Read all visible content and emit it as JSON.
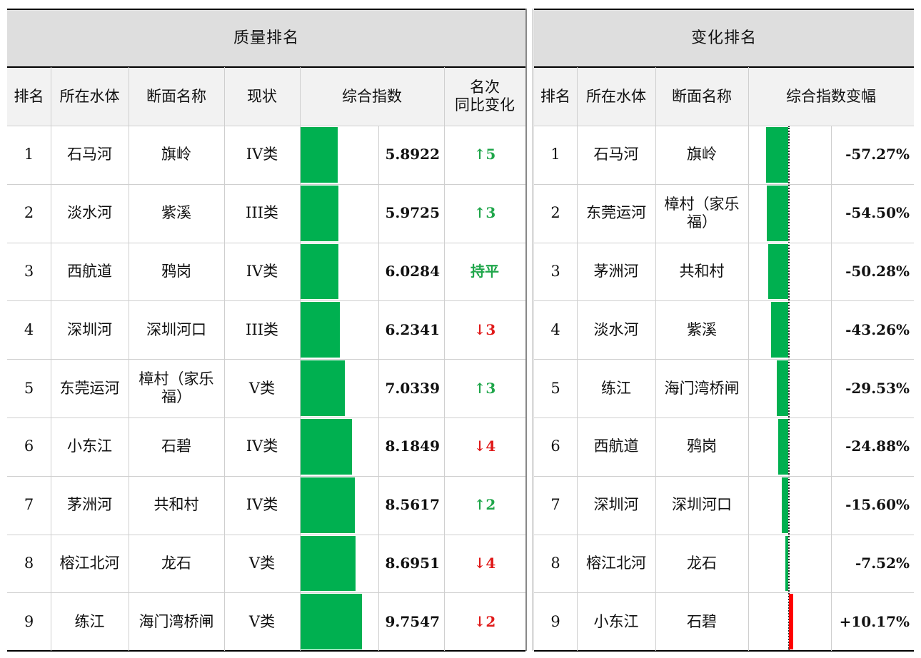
{
  "quality": {
    "title": "质量排名",
    "headers": {
      "rank": "排名",
      "water": "所在水体",
      "section": "断面名称",
      "status": "现状",
      "index": "综合指数",
      "change": "名次\n同比变化"
    },
    "bar_max": 12.0,
    "rows": [
      {
        "rank": "1",
        "water": "石马河",
        "section": "旗岭",
        "status": "IV类",
        "index": 5.8922,
        "index_label": "5.8922",
        "change": "↑5",
        "dir": "up"
      },
      {
        "rank": "2",
        "water": "淡水河",
        "section": "紫溪",
        "status": "III类",
        "index": 5.9725,
        "index_label": "5.9725",
        "change": "↑3",
        "dir": "up"
      },
      {
        "rank": "3",
        "water": "西航道",
        "section": "鸦岗",
        "status": "IV类",
        "index": 6.0284,
        "index_label": "6.0284",
        "change": "持平",
        "dir": "flat"
      },
      {
        "rank": "4",
        "water": "深圳河",
        "section": "深圳河口",
        "status": "III类",
        "index": 6.2341,
        "index_label": "6.2341",
        "change": "↓3",
        "dir": "down"
      },
      {
        "rank": "5",
        "water": "东莞运河",
        "section": "樟村（家乐\n福）",
        "status": "V类",
        "index": 7.0339,
        "index_label": "7.0339",
        "change": "↑3",
        "dir": "up"
      },
      {
        "rank": "6",
        "water": "小东江",
        "section": "石碧",
        "status": "IV类",
        "index": 8.1849,
        "index_label": "8.1849",
        "change": "↓4",
        "dir": "down"
      },
      {
        "rank": "7",
        "water": "茅洲河",
        "section": "共和村",
        "status": "IV类",
        "index": 8.5617,
        "index_label": "8.5617",
        "change": "↑2",
        "dir": "up"
      },
      {
        "rank": "8",
        "water": "榕江北河",
        "section": "龙石",
        "status": "V类",
        "index": 8.6951,
        "index_label": "8.6951",
        "change": "↓4",
        "dir": "down"
      },
      {
        "rank": "9",
        "water": "练江",
        "section": "海门湾桥闸",
        "status": "V类",
        "index": 9.7547,
        "index_label": "9.7547",
        "change": "↓2",
        "dir": "down"
      }
    ]
  },
  "change": {
    "title": "变化排名",
    "headers": {
      "rank": "排名",
      "water": "所在水体",
      "section": "断面名称",
      "delta": "综合指数变幅"
    },
    "bar_max": 100,
    "rows": [
      {
        "rank": "1",
        "water": "石马河",
        "section": "旗岭",
        "delta": -57.27,
        "delta_label": "-57.27%"
      },
      {
        "rank": "2",
        "water": "东莞运河",
        "section": "樟村（家乐\n福）",
        "delta": -54.5,
        "delta_label": "-54.50%"
      },
      {
        "rank": "3",
        "water": "茅洲河",
        "section": "共和村",
        "delta": -50.28,
        "delta_label": "-50.28%"
      },
      {
        "rank": "4",
        "water": "淡水河",
        "section": "紫溪",
        "delta": -43.26,
        "delta_label": "-43.26%"
      },
      {
        "rank": "5",
        "water": "练江",
        "section": "海门湾桥闸",
        "delta": -29.53,
        "delta_label": "-29.53%"
      },
      {
        "rank": "6",
        "water": "西航道",
        "section": "鸦岗",
        "delta": -24.88,
        "delta_label": "-24.88%"
      },
      {
        "rank": "7",
        "water": "深圳河",
        "section": "深圳河口",
        "delta": -15.6,
        "delta_label": "-15.60%"
      },
      {
        "rank": "8",
        "water": "榕江北河",
        "section": "龙石",
        "delta": -7.52,
        "delta_label": "-7.52%"
      },
      {
        "rank": "9",
        "water": "小东江",
        "section": "石碧",
        "delta": 10.17,
        "delta_label": "+10.17%"
      }
    ]
  },
  "colors": {
    "bar_green": "#00b050",
    "bar_red": "#ff0000",
    "arrow_green": "#1fa64a",
    "arrow_red": "#e01b1b",
    "header_gray": "#dedede"
  }
}
